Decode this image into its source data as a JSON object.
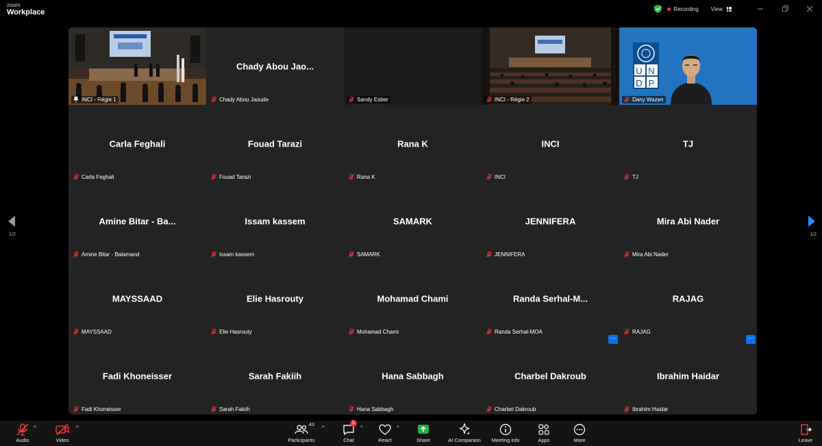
{
  "app": {
    "brand_top": "zoom",
    "brand_bottom": "Workplace"
  },
  "titlebar": {
    "recording": "Recording",
    "view": "View"
  },
  "colors": {
    "active_speaker": "#35c759",
    "recording_dot": "#e5383b",
    "accent_blue": "#0e72ed",
    "muted_red": "#e5383b"
  },
  "pager": {
    "left": "1/2",
    "right": "1/2"
  },
  "tiles": [
    {
      "display": "",
      "label": "INCI - Régie 1",
      "video": true,
      "active": true
    },
    {
      "display": "Chady Abou Jao...",
      "label": "Chady Abou Jaoude",
      "video": false
    },
    {
      "display": "",
      "label": "Sandy Esber",
      "video": true
    },
    {
      "display": "",
      "label": "INCI - Régie 2",
      "video": true
    },
    {
      "display": "",
      "label": "Dany Wazen",
      "video": true
    },
    {
      "display": "Carla Feghali",
      "label": "Carla Feghali"
    },
    {
      "display": "Fouad Tarazi",
      "label": "Fouad Tarazi"
    },
    {
      "display": "Rana K",
      "label": "Rana K"
    },
    {
      "display": "INCI",
      "label": "INCI"
    },
    {
      "display": "TJ",
      "label": "TJ"
    },
    {
      "display": "Amine Bitar - Ba...",
      "label": "Amine Bitar - Balamand"
    },
    {
      "display": "Issam kassem",
      "label": "Issam kassem"
    },
    {
      "display": "SAMARK",
      "label": "SAMARK"
    },
    {
      "display": "JENNIFERA",
      "label": "JENNIFERA"
    },
    {
      "display": "Mira Abi Nader",
      "label": "Mira Abi Nader"
    },
    {
      "display": "MAYSSAAD",
      "label": "MAYSSAAD"
    },
    {
      "display": "Elie Hasrouty",
      "label": "Elie Hasrouty"
    },
    {
      "display": "Mohamad Chami",
      "label": "Mohamad Chami"
    },
    {
      "display": "Randa  Serhal-M...",
      "label": "Randa Serhal-MOA"
    },
    {
      "display": "RAJAG",
      "label": "RAJAG"
    },
    {
      "display": "Fadi Khoneisser",
      "label": "Fadi Khoneisser"
    },
    {
      "display": "Sarah Fakiih",
      "label": "Sarah Fakiih"
    },
    {
      "display": "Hana Sabbagh",
      "label": "Hana Sabbagh"
    },
    {
      "display": "Charbel Dakroub",
      "label": "Charbel Dakroub"
    },
    {
      "display": "Ibrahim Haidar",
      "label": "Ibrahim Haidar"
    }
  ],
  "undp_letters": [
    "U",
    "N",
    "D",
    "P"
  ],
  "more_button": "···",
  "toolbar": {
    "audio": "Audio",
    "video": "Video",
    "participants": "Participants",
    "participants_count": "43",
    "chat": "Chat",
    "chat_badge": "5",
    "react": "React",
    "share": "Share",
    "ai_companion": "AI Companion",
    "meeting_info": "Meeting info",
    "apps": "Apps",
    "more": "More",
    "leave": "Leave"
  }
}
